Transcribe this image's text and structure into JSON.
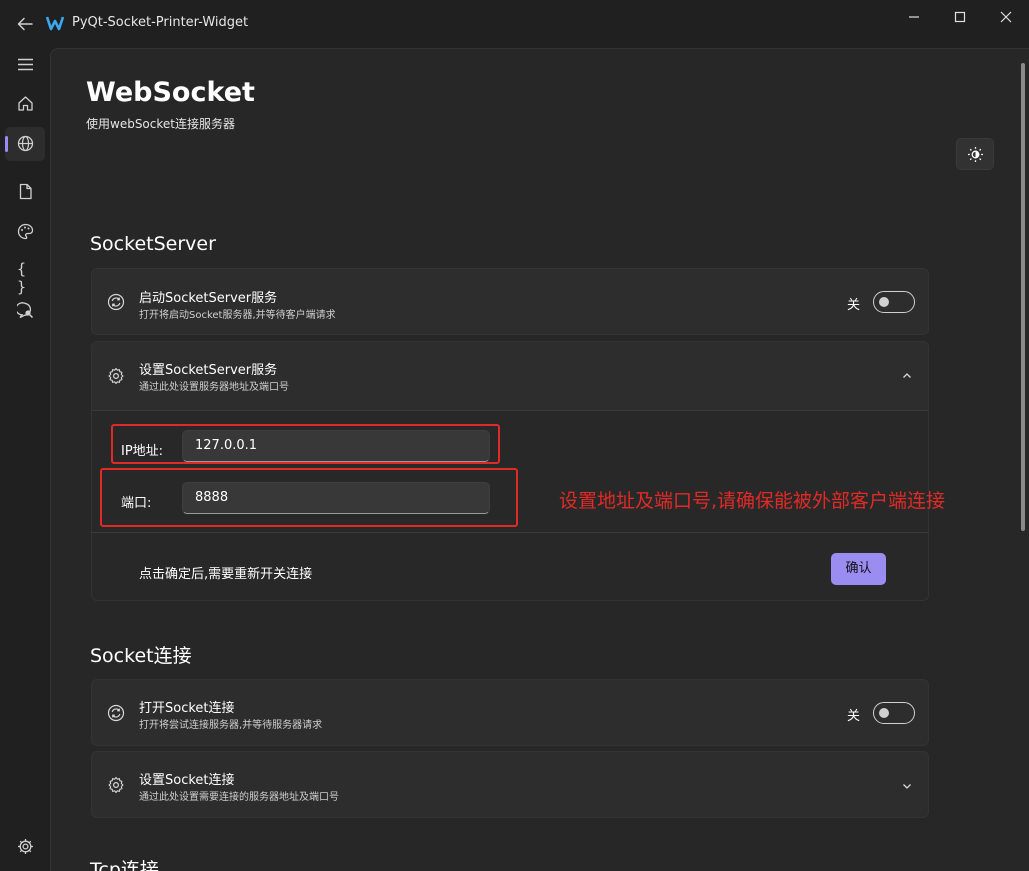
{
  "window": {
    "title": "PyQt-Socket-Printer-Widget"
  },
  "nav": {
    "items": [
      {
        "name": "menu",
        "icon": "hamburger-icon"
      },
      {
        "name": "home",
        "icon": "home-icon"
      },
      {
        "name": "websocket",
        "icon": "globe-icon",
        "active": true
      },
      {
        "name": "document",
        "icon": "document-icon"
      },
      {
        "name": "palette",
        "icon": "palette-icon"
      },
      {
        "name": "code",
        "icon": "braces-icon",
        "glyph": "{ }"
      },
      {
        "name": "search-chat",
        "icon": "chat-search-icon"
      }
    ],
    "settings_icon": "gear-icon"
  },
  "page": {
    "title": "WebSocket",
    "subtitle": "使用webSocket连接服务器"
  },
  "socket_server": {
    "section_title": "SocketServer",
    "start_card": {
      "title": "启动SocketServer服务",
      "desc": "打开将启动Socket服务器,并等待客户端请求",
      "toggle_label": "关",
      "toggle_on": false
    },
    "settings_card": {
      "title": "设置SocketServer服务",
      "desc": "通过此处设置服务器地址及端口号",
      "expanded": true,
      "ip_label": "IP地址:",
      "ip_value": "127.0.0.1",
      "port_label": "端口:",
      "port_value": "8888",
      "footer_note": "点击确定后,需要重新开关连接",
      "confirm_label": "确认"
    }
  },
  "socket_connect": {
    "section_title": "Socket连接",
    "open_card": {
      "title": "打开Socket连接",
      "desc": "打开将尝试连接服务器,并等待服务器请求",
      "toggle_label": "关",
      "toggle_on": false
    },
    "settings_card": {
      "title": "设置Socket连接",
      "desc": "通过此处设置需要连接的服务器地址及端口号",
      "expanded": false
    }
  },
  "tcp": {
    "section_title": "Tcp连接"
  },
  "annotation": {
    "text": "设置地址及端口号,请确保能被外部客户端连接",
    "color": "#e02a25"
  },
  "colors": {
    "accent": "#9b8cf2",
    "background": "#202020",
    "panel": "#272727",
    "card": "#2d2d2d"
  }
}
